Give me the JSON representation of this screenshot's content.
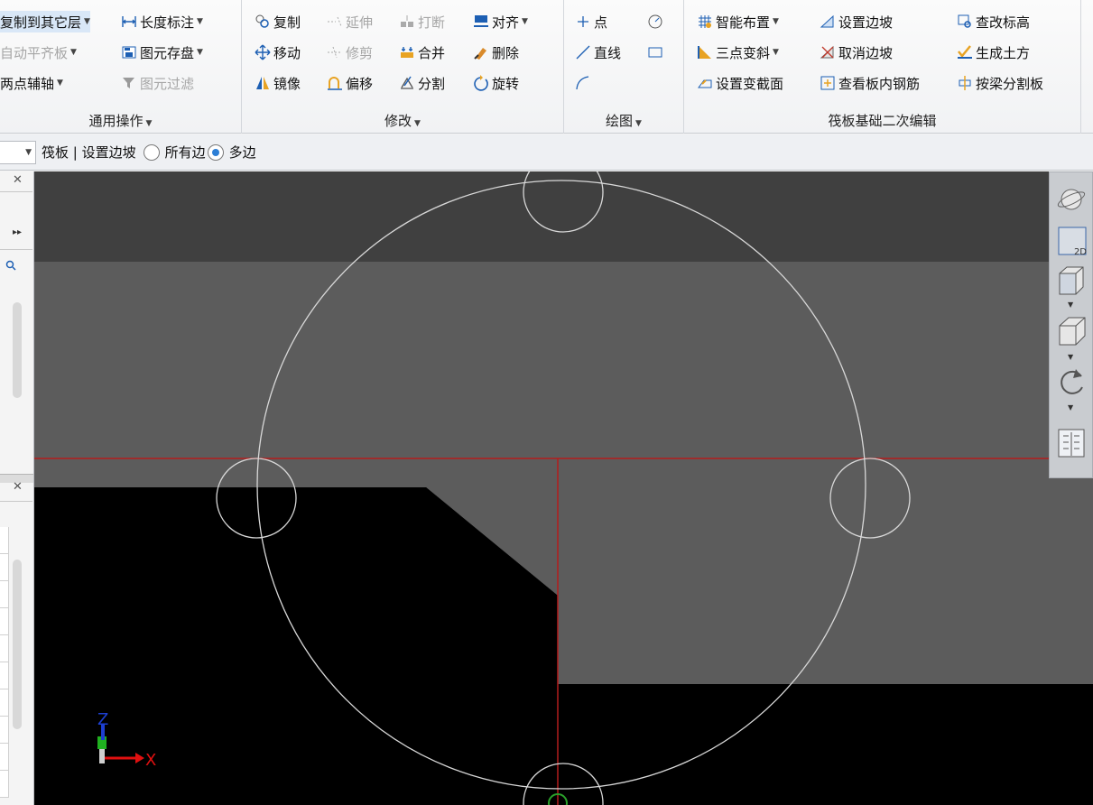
{
  "ribbon": {
    "general": {
      "items": [
        "复制到其它层",
        "长度标注",
        "自动平齐板",
        "图元存盘",
        "两点辅轴",
        "图元过滤"
      ],
      "label": "通用操作"
    },
    "modify": {
      "items": [
        "复制",
        "延伸",
        "打断",
        "对齐",
        "移动",
        "修剪",
        "合并",
        "删除",
        "镜像",
        "偏移",
        "分割",
        "旋转"
      ],
      "label": "修改"
    },
    "draw": {
      "items": [
        "点",
        "直线"
      ],
      "label": "绘图"
    },
    "raft": {
      "items": [
        "智能布置",
        "设置边坡",
        "查改标高",
        "三点变斜",
        "取消边坡",
        "生成土方",
        "设置变截面",
        "查看板内钢筋",
        "按梁分割板"
      ],
      "label": "筏板基础二次编辑"
    }
  },
  "toolbar2": {
    "context": "筏板 | 设置边坡",
    "options": [
      "所有边",
      "多边"
    ],
    "selected": "多边"
  },
  "view": {
    "view2d_label": "2D",
    "axis_z": "Z",
    "axis_x": "X",
    "colors": {
      "light_gray": "#404040",
      "mid_gray": "#5c5c5c",
      "black": "#000000",
      "red_axis": "#b31d1d",
      "circle": "#d8d8d8"
    }
  }
}
